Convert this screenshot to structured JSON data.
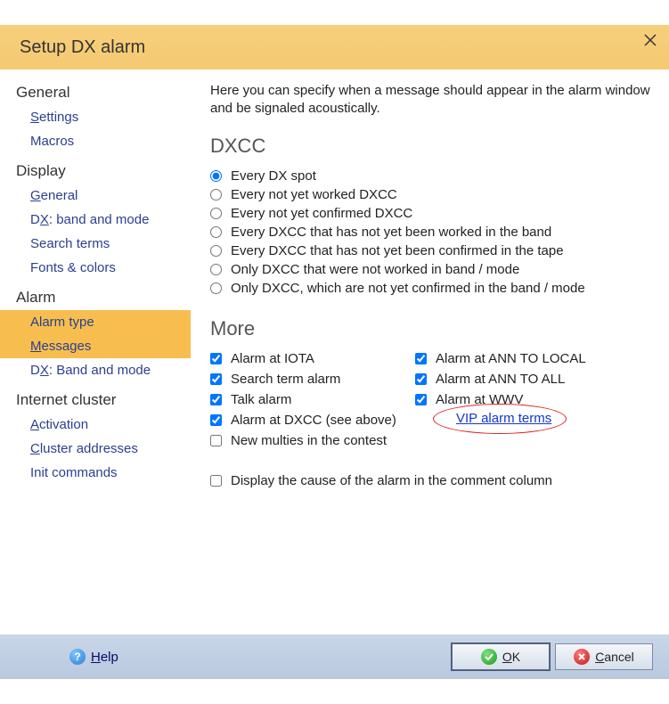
{
  "window": {
    "title": "Setup DX alarm"
  },
  "sidebar": {
    "groups": [
      {
        "head": "General",
        "items": [
          {
            "label": "Settings",
            "mn": "S",
            "sel": false
          },
          {
            "label": "Macros",
            "mn": "",
            "sel": false
          }
        ]
      },
      {
        "head": "Display",
        "items": [
          {
            "label": "General",
            "mn": "G",
            "sel": false
          },
          {
            "label": "DX: band and mode",
            "mn": "X",
            "sel": false
          },
          {
            "label": "Search terms",
            "mn": "",
            "sel": false
          },
          {
            "label": "Fonts & colors",
            "mn": "",
            "sel": false
          }
        ]
      },
      {
        "head": "Alarm",
        "items": [
          {
            "label": "Alarm type",
            "mn": "",
            "sel": true
          },
          {
            "label": "Messages",
            "mn": "M",
            "sel": true
          },
          {
            "label": "DX: Band and mode",
            "mn": "X",
            "sel": false
          }
        ]
      },
      {
        "head": "Internet cluster",
        "items": [
          {
            "label": "Activation",
            "mn": "A",
            "sel": false
          },
          {
            "label": "Cluster addresses",
            "mn": "C",
            "sel": false
          },
          {
            "label": "Init commands",
            "mn": "",
            "sel": false
          }
        ]
      }
    ]
  },
  "content": {
    "intro": "Here you can specify when a message should appear in the alarm window and be signaled acoustically.",
    "dxcc_head": "DXCC",
    "dxcc_options": [
      {
        "label": "Every DX spot",
        "checked": true
      },
      {
        "label": "Every not yet worked DXCC",
        "checked": false
      },
      {
        "label": "Every not yet confirmed DXCC",
        "checked": false
      },
      {
        "label": "Every DXCC that has not yet been worked in the band",
        "checked": false
      },
      {
        "label": "Every DXCC that has not yet been confirmed in the tape",
        "checked": false
      },
      {
        "label": "Only DXCC that were not worked in band / mode",
        "checked": false
      },
      {
        "label": "Only DXCC, which are not yet confirmed in the band / mode",
        "checked": false
      }
    ],
    "more_head": "More",
    "more_left": [
      {
        "label": "Alarm at IOTA",
        "checked": true
      },
      {
        "label": "Search term alarm",
        "checked": true
      },
      {
        "label": "Talk alarm",
        "checked": true
      },
      {
        "label": "Alarm at DXCC (see above)",
        "checked": true
      },
      {
        "label": "New multies in the contest",
        "checked": false
      }
    ],
    "more_right": [
      {
        "label": "Alarm at ANN TO LOCAL",
        "checked": true
      },
      {
        "label": "Alarm at ANN TO ALL",
        "checked": true
      },
      {
        "label": "Alarm at WWV",
        "checked": true
      }
    ],
    "vip_link": "VIP alarm terms",
    "display_cause": {
      "label": "Display the cause of the alarm in the comment column",
      "checked": false
    }
  },
  "footer": {
    "help": "Help",
    "ok": "OK",
    "cancel": "Cancel"
  }
}
